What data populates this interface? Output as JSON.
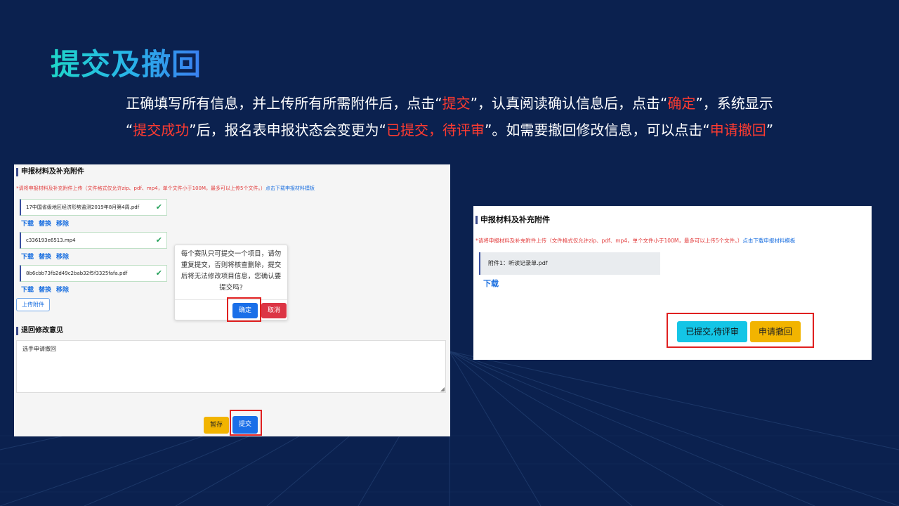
{
  "slide": {
    "title": "提交及撤回",
    "intro": {
      "l1_a": "正确填写所有信息，并上传所有所需附件后，点击“",
      "l1_hl1": "提交",
      "l1_b": "”，认真阅读确认信息后，点击“",
      "l1_hl2": "确定",
      "l1_c": "”，系统显示",
      "l2_a": "“",
      "l2_hl1": "提交成功",
      "l2_b": "”后，报名表申报状态会变更为“",
      "l2_hl2": "已提交，待评审",
      "l2_c": "”。如需要撤回修改信息，可以点击“",
      "l2_hl3": "申请撤回",
      "l2_d": "”"
    }
  },
  "left_shot": {
    "section_title": "申报材料及补充附件",
    "notice": "*请将申报材料及补充附件上传（文件格式仅允许zip、pdf、mp4，单个文件小于100M，最多可以上传5个文件。）",
    "notice_link": "点击下载申报材料模板",
    "files": [
      {
        "name": "17中国省级地区经济形势监测2019年8月第4周.pdf"
      },
      {
        "name": "c336193e6513.mp4"
      },
      {
        "name": "8b6cbb73fb2d49c2bab32f5f3325fafa.pdf"
      }
    ],
    "file_actions": {
      "download": "下载",
      "replace": "替换",
      "remove": "移除"
    },
    "upload_label": "上传附件",
    "popover_text": "每个赛队只可提交一个项目，请勿重复提交，否则将核查删除，提交后将无法修改项目信息，您确认要提交吗?",
    "confirm_label": "确定",
    "cancel_label": "取消",
    "feedback_title": "退回修改意见",
    "feedback_value": "选手申请撤回",
    "save_label": "暂存",
    "submit_label": "提交"
  },
  "right_shot": {
    "section_title": "申报材料及补充附件",
    "notice": "*请将申报材料及补充附件上传（文件格式仅允许zip、pdf、mp4，单个文件小于100M，最多可以上传5个文件。）",
    "notice_link": "点击下载申报材料模板",
    "attachment": "附件1：听读记录单.pdf",
    "download_label": "下载",
    "status_label": "已提交,待评审",
    "withdraw_label": "申请撤回"
  },
  "colors": {
    "background": "#0b214f",
    "highlight": "#ff3b30",
    "primary": "#1a6fe8",
    "danger": "#dc3545",
    "warning": "#f2b400",
    "info": "#14c5e6"
  }
}
